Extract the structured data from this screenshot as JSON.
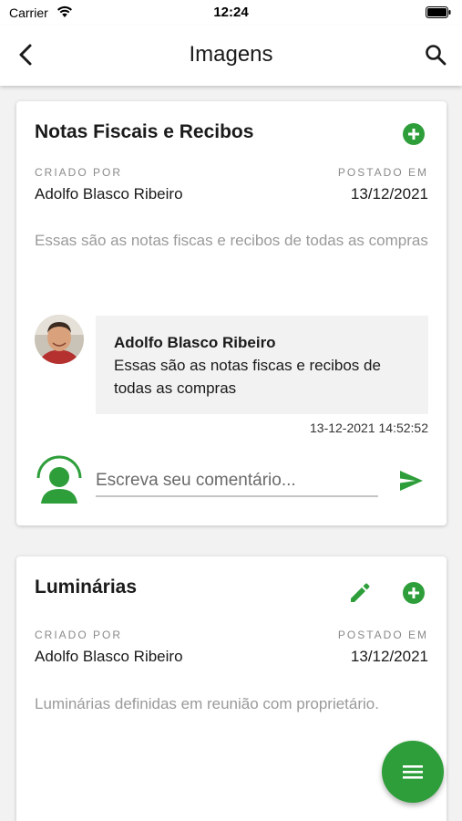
{
  "status_bar": {
    "carrier": "Carrier",
    "time": "12:24"
  },
  "app_bar": {
    "title": "Imagens",
    "back_icon": "back-arrow-icon",
    "search_icon": "search-icon"
  },
  "colors": {
    "accent": "#2e9e3a",
    "label": "#8a8a8a",
    "muted_text": "#9a9a9a",
    "bubble": "#f2f2f2"
  },
  "cards": [
    {
      "title": "Notas Fiscais e Recibos",
      "actions": [
        "add-circle-icon"
      ],
      "created_by_label": "CRIADO POR",
      "created_by": "Adolfo Blasco Ribeiro",
      "posted_label": "POSTADO EM",
      "posted_date": "13/12/2021",
      "description": "Essas são as notas fiscas e recibos de todas as compras",
      "comments": [
        {
          "author": "Adolfo Blasco Ribeiro",
          "text": "Essas são as notas fiscas e recibos de todas as compras",
          "timestamp": "13-12-2021 14:52:52"
        }
      ],
      "comment_input_placeholder": "Escreva seu comentário..."
    },
    {
      "title": "Luminárias",
      "actions": [
        "edit-pencil-icon",
        "add-circle-icon"
      ],
      "created_by_label": "CRIADO POR",
      "created_by": "Adolfo Blasco Ribeiro",
      "posted_label": "POSTADO EM",
      "posted_date": "13/12/2021",
      "description": "Luminárias definidas em reunião com proprietário."
    }
  ],
  "fab": {
    "icon": "menu-icon"
  }
}
